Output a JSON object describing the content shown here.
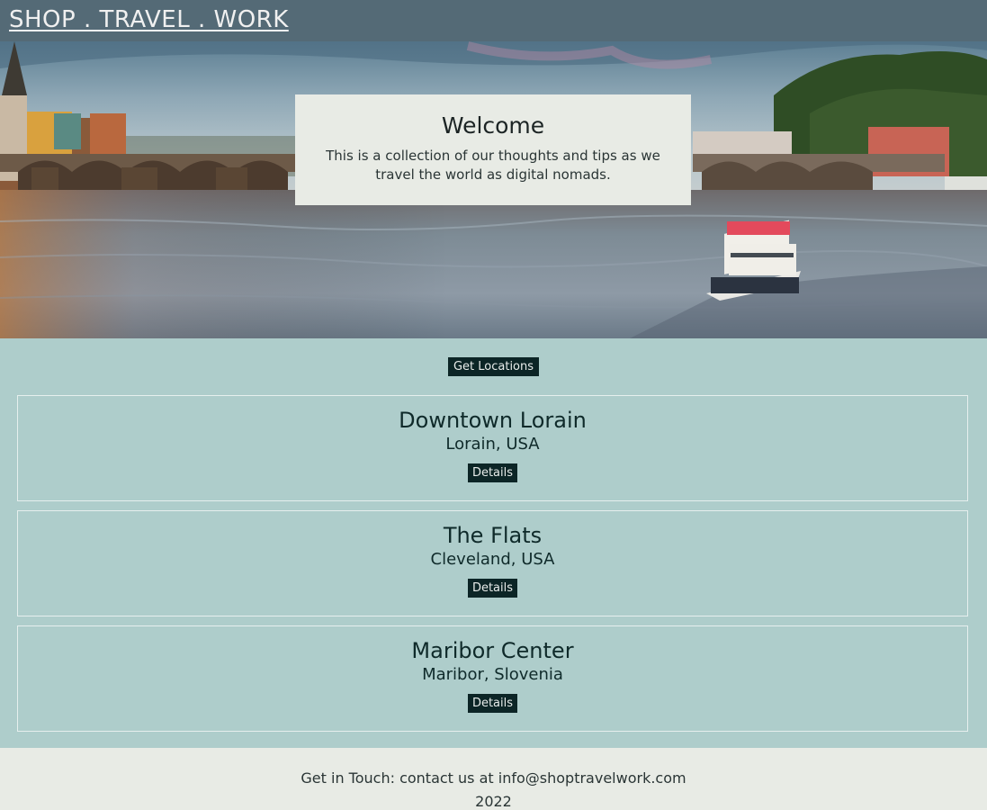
{
  "header": {
    "title": "SHOP . TRAVEL . WORK"
  },
  "hero": {
    "image_icon": "river-city-bridge-photo",
    "welcome_title": "Welcome",
    "welcome_text": "This is a collection of our thoughts and tips as we travel the world as digital nomads."
  },
  "main": {
    "get_locations_label": "Get Locations",
    "locations": [
      {
        "name": "Downtown Lorain",
        "place": "Lorain, USA",
        "details_label": "Details"
      },
      {
        "name": "The Flats",
        "place": "Cleveland, USA",
        "details_label": "Details"
      },
      {
        "name": "Maribor Center",
        "place": "Maribor, Slovenia",
        "details_label": "Details"
      }
    ]
  },
  "footer": {
    "contact": "Get in Touch: contact us at info@shoptravelwork.com",
    "year": "2022"
  },
  "colors": {
    "header_bg": "#546a76",
    "main_bg": "#aecdcb",
    "card_bg": "#e8ebe5",
    "button_bg": "#0c2526"
  }
}
